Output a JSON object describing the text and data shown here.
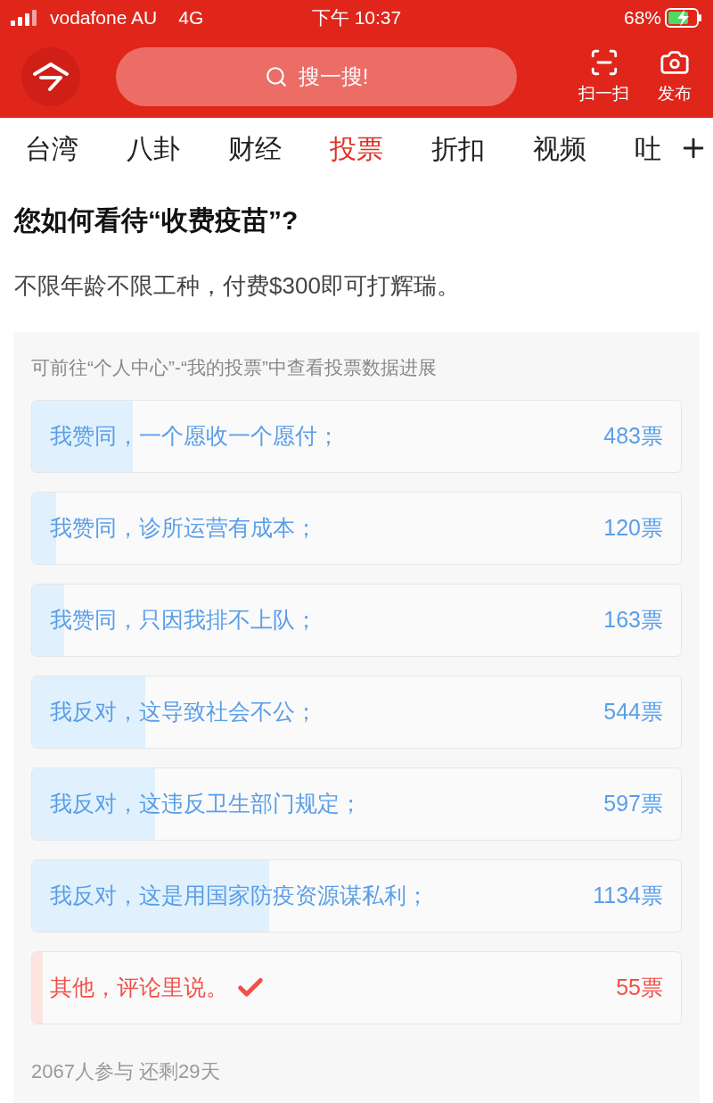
{
  "status_bar": {
    "carrier": "vodafone AU",
    "network": "4G",
    "time": "下午 10:37",
    "battery": "68%"
  },
  "header": {
    "search": {
      "placeholder": "搜一搜!"
    },
    "actions": [
      {
        "kind": "scan",
        "label": "扫一扫"
      },
      {
        "kind": "camera",
        "label": "发布"
      }
    ]
  },
  "tabs": [
    {
      "label": "台湾",
      "selected": false
    },
    {
      "label": "八卦",
      "selected": false
    },
    {
      "label": "财经",
      "selected": false
    },
    {
      "label": "投票",
      "selected": true
    },
    {
      "label": "折扣",
      "selected": false
    },
    {
      "label": "视频",
      "selected": false
    },
    {
      "label": "吐",
      "selected": false
    }
  ],
  "poll": {
    "question": "您如何看待“收费疫苗”?",
    "description": "不限年龄不限工种，付费$300即可打辉瑞。",
    "hint": "可前往“个人中心”-“我的投票”中查看投票数据进展",
    "options": [
      {
        "text": "我赞同，一个愿收一个愿付；",
        "votes": "483票",
        "level": 0.155,
        "selected": false
      },
      {
        "text": "我赞同，诊所运营有成本；",
        "votes": "120票",
        "level": 0.037,
        "selected": false
      },
      {
        "text": "我赞同，只因我排不上队；",
        "votes": "163票",
        "level": 0.05,
        "selected": false
      },
      {
        "text": "我反对，这导致社会不公；",
        "votes": "544票",
        "level": 0.174,
        "selected": false
      },
      {
        "text": "我反对，这违反卫生部门规定；",
        "votes": "597票",
        "level": 0.19,
        "selected": false
      },
      {
        "text": "我反对，这是用国家防疫资源谋私利；",
        "votes": "1134票",
        "level": 0.365,
        "selected": false
      },
      {
        "text": "其他，评论里说。",
        "votes": "55票",
        "level": 0.016,
        "selected": true
      }
    ],
    "footer": "2067人参与 还剩29天"
  }
}
